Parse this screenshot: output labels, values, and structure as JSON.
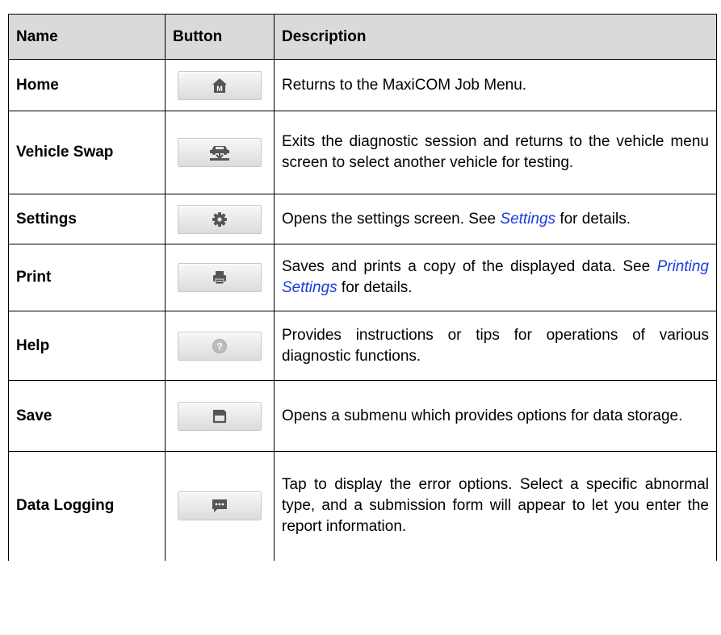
{
  "header": {
    "name": "Name",
    "button": "Button",
    "description": "Description"
  },
  "rows": [
    {
      "name": "Home",
      "icon": "home-icon",
      "desc_pre": "Returns to the MaxiCOM Job Menu.",
      "link": "",
      "desc_post": ""
    },
    {
      "name": "Vehicle Swap",
      "icon": "vehicle-swap-icon",
      "desc_pre": "Exits the diagnostic session and returns to the vehicle menu screen to select another vehicle for testing.",
      "link": "",
      "desc_post": ""
    },
    {
      "name": "Settings",
      "icon": "gear-icon",
      "desc_pre": "Opens the settings screen. See ",
      "link": "Settings",
      "desc_post": " for details."
    },
    {
      "name": "Print",
      "icon": "printer-icon",
      "desc_pre": "Saves and prints a copy of the displayed data. See ",
      "link": "Printing Settings",
      "desc_post": " for details."
    },
    {
      "name": "Help",
      "icon": "help-icon",
      "desc_pre": "Provides instructions or tips for operations of various diagnostic functions.",
      "link": "",
      "desc_post": ""
    },
    {
      "name": "Save",
      "icon": "save-icon",
      "desc_pre": "Opens a submenu which provides options for data storage.",
      "link": "",
      "desc_post": ""
    },
    {
      "name": "Data Logging",
      "icon": "data-logging-icon",
      "desc_pre": "Tap to display the error options. Select a specific abnormal type, and a submission form will appear to let you enter the report information.",
      "link": "",
      "desc_post": ""
    }
  ],
  "home_icon_letter": "M",
  "colors": {
    "header_bg": "#dadada",
    "link": "#1a3bdc",
    "icon": "#555555"
  }
}
